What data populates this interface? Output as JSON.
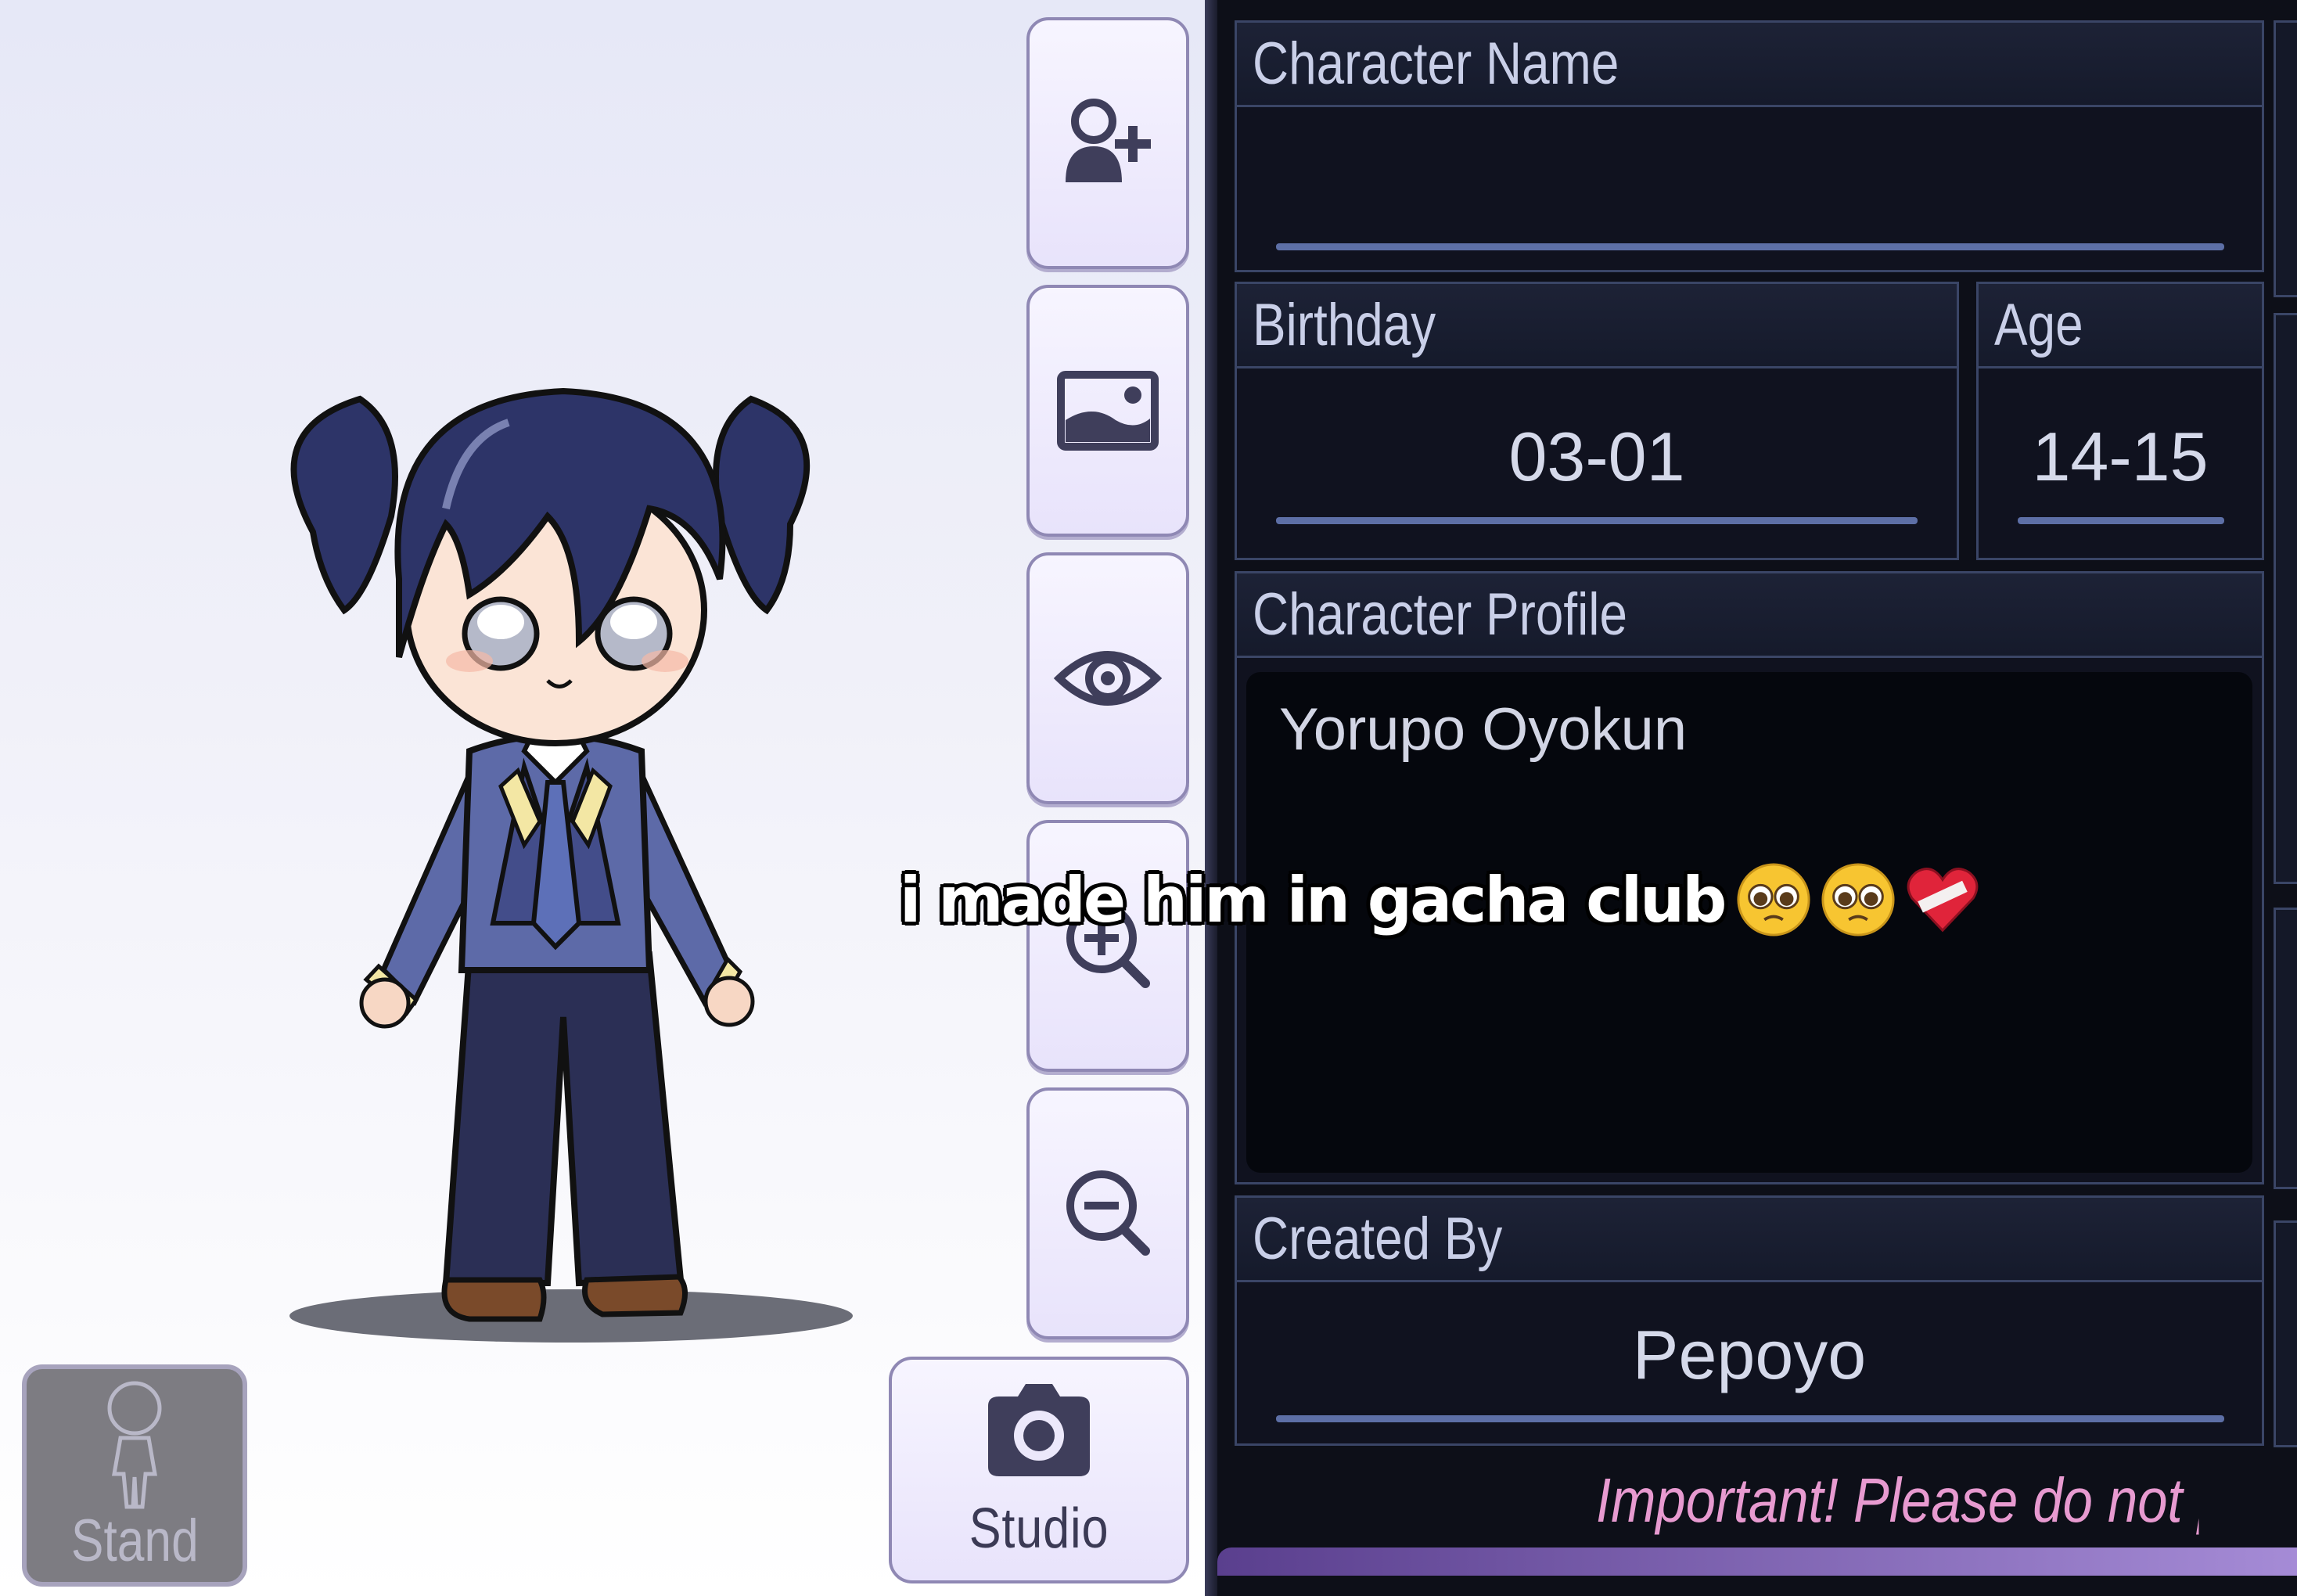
{
  "toolbar": {
    "buttons": [
      {
        "icon": "add-person-icon"
      },
      {
        "icon": "image-icon"
      },
      {
        "icon": "eye-icon"
      },
      {
        "icon": "zoom-in-icon"
      },
      {
        "icon": "zoom-out-icon"
      }
    ],
    "studio_label": "Studio",
    "stand_label": "Stand"
  },
  "profile": {
    "character_name_label": "Character Name",
    "character_name_value": "",
    "birthday_label": "Birthday",
    "birthday_value": "03-01",
    "age_label": "Age",
    "age_value": "14-15",
    "profile_label": "Character Profile",
    "profile_value": "Yorupo Oyokun",
    "created_by_label": "Created By",
    "created_by_value": "Pepoyo",
    "important_notice": "Important! Please do not pu"
  },
  "caption": {
    "text": "i made him in gacha club",
    "emojis": [
      "pleading-face-icon",
      "pleading-face-icon",
      "mending-heart-icon"
    ]
  },
  "colors": {
    "panel_bg": "#0d0f18",
    "field_border": "#3a4566",
    "underline": "#5d6fa6",
    "notice": "#e79ad0",
    "hair": "#2d3468",
    "jacket": "#5d6aa8"
  }
}
